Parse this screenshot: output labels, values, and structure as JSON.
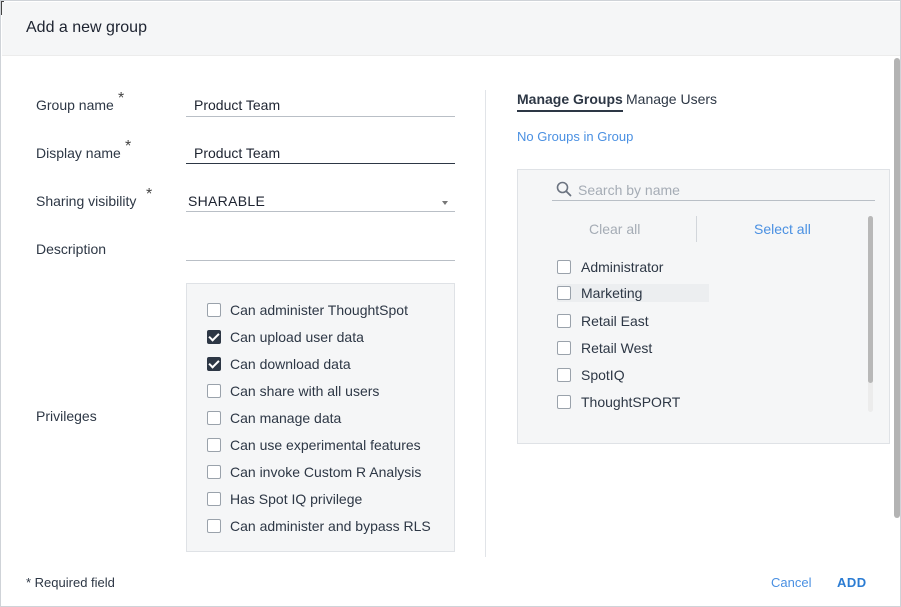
{
  "dialog": {
    "title": "Add a new group",
    "required_note": "* Required field",
    "cancel_label": "Cancel",
    "add_label": "ADD"
  },
  "form": {
    "group_name": {
      "label": "Group name",
      "required": "*",
      "value": "Product Team"
    },
    "display_name": {
      "label": "Display name",
      "required": "*",
      "value": "Product Team"
    },
    "sharing_visibility": {
      "label": "Sharing visibility",
      "required": "*",
      "value": "SHARABLE"
    },
    "description": {
      "label": "Description",
      "value": ""
    },
    "privileges": {
      "label": "Privileges",
      "items": [
        {
          "label": "Can administer ThoughtSpot",
          "checked": false
        },
        {
          "label": "Can upload user data",
          "checked": true
        },
        {
          "label": "Can download data",
          "checked": true
        },
        {
          "label": "Can share with all users",
          "checked": false
        },
        {
          "label": "Can manage data",
          "checked": false
        },
        {
          "label": "Can use experimental features",
          "checked": false
        },
        {
          "label": "Can invoke Custom R Analysis",
          "checked": false
        },
        {
          "label": "Has Spot IQ privilege",
          "checked": false
        },
        {
          "label": "Can administer and bypass RLS",
          "checked": false
        }
      ]
    }
  },
  "right_panel": {
    "tabs": [
      {
        "label": "Manage Groups",
        "active": true
      },
      {
        "label": "Manage Users",
        "active": false
      }
    ],
    "no_groups_text": "No Groups in Group",
    "search": {
      "placeholder": "Search by name",
      "value": ""
    },
    "clear_all_label": "Clear all",
    "select_all_label": "Select all",
    "groups": [
      {
        "label": "Administrator",
        "checked": false
      },
      {
        "label": "Marketing",
        "checked": false
      },
      {
        "label": "Retail East",
        "checked": false
      },
      {
        "label": "Retail West",
        "checked": false
      },
      {
        "label": "SpotIQ",
        "checked": false
      },
      {
        "label": "ThoughtSPORT",
        "checked": false
      }
    ]
  },
  "colors": {
    "accent": "#4a90e2",
    "text": "#2d3745",
    "panel_bg": "#f5f6f7"
  }
}
